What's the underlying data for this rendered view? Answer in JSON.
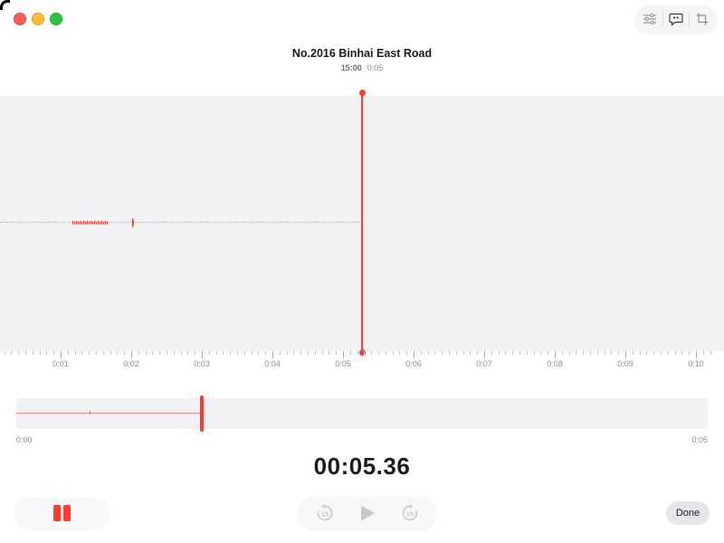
{
  "recording": {
    "title": "No.2016 Binhai East Road",
    "date": "15:00",
    "duration": "0:05"
  },
  "timeline": {
    "labels": [
      "0:01",
      "0:02",
      "0:03",
      "0:04",
      "0:05",
      "0:06",
      "0:07",
      "0:08",
      "0:09",
      "0:10"
    ]
  },
  "overview": {
    "start_label": "0:00",
    "end_label": "0:05"
  },
  "playback": {
    "current_time": "00:05.36"
  },
  "buttons": {
    "done_label": "Done"
  },
  "colors": {
    "accent": "#ff3b30",
    "waveform_bg": "#f2f2f4"
  },
  "icons": {
    "settings": "sliders-icon",
    "transcript": "quote-bubble-icon",
    "trim": "crop-icon",
    "skip_back": "skip-back-15-icon",
    "play": "play-icon",
    "skip_forward": "skip-forward-15-icon",
    "pause": "pause-icon"
  }
}
